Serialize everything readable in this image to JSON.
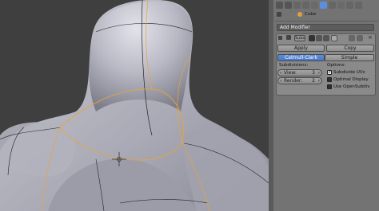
{
  "header": {
    "object_name": "Cube",
    "icons": [
      "render-icon",
      "scene-icon",
      "world-icon",
      "object-icon",
      "constraint-icon",
      "modifier-icon",
      "data-icon",
      "material-icon",
      "particles-icon",
      "physics-icon"
    ]
  },
  "modifier_panel": {
    "add_modifier_label": "Add Modifier",
    "modifier_name": "Subs",
    "apply_label": "Apply",
    "copy_label": "Copy",
    "type_catmull": "Catmull-Clark",
    "type_simple": "Simple",
    "subdivisions_label": "Subdivisions:",
    "view_label": "View:",
    "view_value": "3",
    "render_label": "Render:",
    "render_value": "2",
    "options_label": "Options:",
    "subdivide_uvs_label": "Subdivide UVs",
    "subdivide_uvs_checked": true,
    "optimal_display_label": "Optimal Display",
    "optimal_display_checked": false,
    "use_opensubdiv_label": "Use OpenSubdiv",
    "use_opensubdiv_checked": false
  },
  "colors": {
    "active_button": "#5b8ede",
    "wire_selected": "#e8a33a",
    "mesh_gray": "#b8b8c4"
  }
}
